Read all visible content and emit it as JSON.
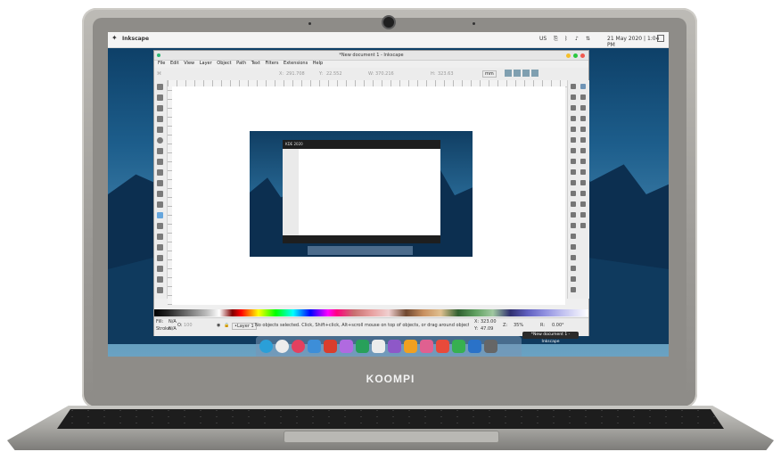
{
  "laptop": {
    "brand": "KOOMPI"
  },
  "desktop": {
    "app_title": "Inkscape",
    "keyboard_layout": "US",
    "clock": "21 May 2020 | 1:04 PM"
  },
  "inkscape": {
    "window_title": "*New document 1 - Inkscape",
    "menu": [
      "File",
      "Edit",
      "View",
      "Layer",
      "Object",
      "Path",
      "Text",
      "Filters",
      "Extensions",
      "Help"
    ],
    "controls": {
      "x": "291.708",
      "y": "22.552",
      "w": "370.216",
      "h": "323.63",
      "unit": "mm"
    },
    "status": {
      "fill_label": "Fill:",
      "fill_value": "N/A",
      "stroke_label": "Stroke:",
      "stroke_value": "N/A",
      "opacity_label": "O:",
      "opacity_value": "100",
      "layer": "•Layer 1",
      "message": "No objects selected. Click, Shift+click, Alt+scroll mouse on top of objects, or drag around objects to select.",
      "coord_x_label": "X:",
      "coord_x": "323.00",
      "coord_y_label": "Y:",
      "coord_y": "47.09",
      "zoom_label": "Z:",
      "zoom": "35%",
      "rotate_label": "R:",
      "rotate": "0.00°"
    },
    "taskbar_tooltip": "*New document 1 - Inkscape"
  },
  "inner_screenshot": {
    "title": "KDE 2020"
  },
  "colors": {
    "wallpaper_top": "#0b3b62",
    "wallpaper_bottom": "#6aa2c2",
    "laptop_silver": "#a8a6a2"
  }
}
